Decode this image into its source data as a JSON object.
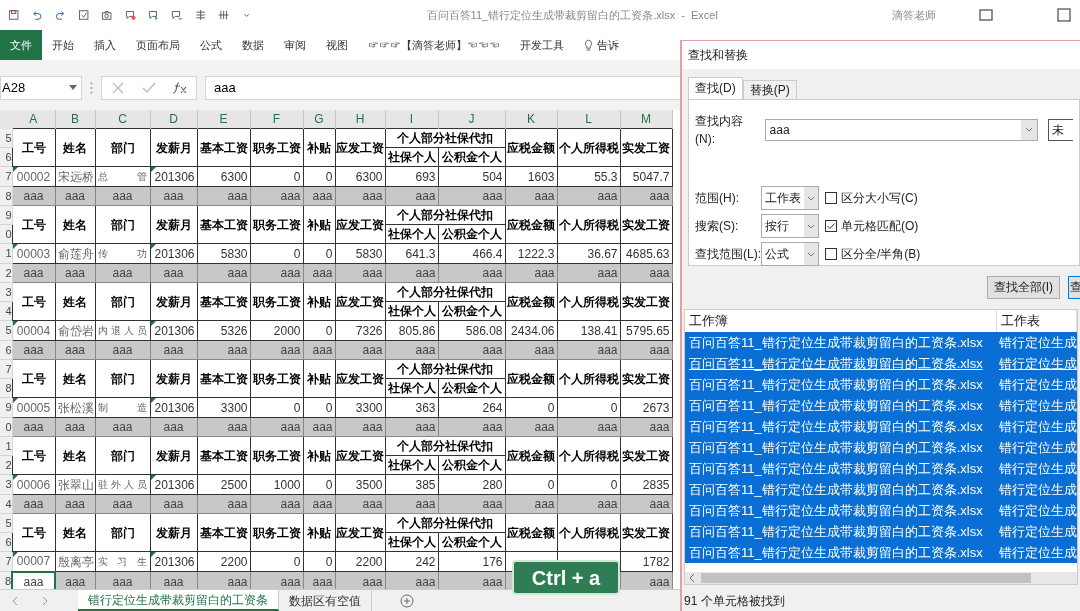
{
  "title_bar": {
    "title": "百问百答11_错行定位生成带裁剪留白的工资条.xlsx  -  Excel",
    "user": "滴答老师"
  },
  "ribbon_tabs": [
    {
      "label": "文件",
      "selected": true
    },
    {
      "label": "开始",
      "selected": false
    },
    {
      "label": "插入",
      "selected": false
    },
    {
      "label": "页面布局",
      "selected": false
    },
    {
      "label": "公式",
      "selected": false
    },
    {
      "label": "数据",
      "selected": false
    },
    {
      "label": "审阅",
      "selected": false
    },
    {
      "label": "视图",
      "selected": false
    },
    {
      "label": "☞☞☞【滴答老师】☜☜☜",
      "selected": false
    },
    {
      "label": "开发工具",
      "selected": false
    },
    {
      "label": "告诉",
      "selected": false
    }
  ],
  "formula_bar": {
    "name_box": "A28",
    "value": "aaa"
  },
  "columns": [
    "A",
    "B",
    "C",
    "D",
    "E",
    "F",
    "G",
    "H",
    "I",
    "J",
    "K",
    "L",
    "M"
  ],
  "blocks": [
    {
      "row_numbers": [
        "5",
        "6",
        "7",
        "8"
      ],
      "headers": [
        "工号",
        "姓名",
        "部门",
        "发薪月",
        "基本工资",
        "职务工资",
        "补贴",
        "应发工资",
        "个人部分社保代扣",
        "社保个人",
        "公积金个人",
        "应税金额",
        "个人所得税",
        "实发工资"
      ],
      "data": [
        "00002",
        "宋远桥",
        "总 管",
        "201306",
        "6300",
        "0",
        "0",
        "6300",
        "693",
        "504",
        "1603",
        "55.3",
        "5047.7"
      ],
      "error_marks": true,
      "filler": [
        "aaa",
        "aaa",
        "aaa",
        "aaa",
        "aaa",
        "aaa",
        "aaa",
        "aaa",
        "aaa",
        "aaa",
        "aaa",
        "aaa",
        "aaa"
      ],
      "first_cell_selected": false
    },
    {
      "row_numbers": [
        "9",
        "0",
        "1",
        "2"
      ],
      "headers": [
        "工号",
        "姓名",
        "部门",
        "发薪月",
        "基本工资",
        "职务工资",
        "补贴",
        "应发工资",
        "个人部分社保代扣",
        "社保个人",
        "公积金个人",
        "应税金额",
        "个人所得税",
        "实发工资"
      ],
      "data": [
        "00003",
        "俞莲舟",
        "传 功",
        "201306",
        "5830",
        "0",
        "0",
        "5830",
        "641.3",
        "466.4",
        "1222.3",
        "36.67",
        "4685.63"
      ],
      "error_marks": true,
      "filler": [
        "aaa",
        "aaa",
        "aaa",
        "aaa",
        "aaa",
        "aaa",
        "aaa",
        "aaa",
        "aaa",
        "aaa",
        "aaa",
        "aaa",
        "aaa"
      ],
      "first_cell_selected": false
    },
    {
      "row_numbers": [
        "3",
        "4",
        "5",
        "6"
      ],
      "headers": [
        "工号",
        "姓名",
        "部门",
        "发薪月",
        "基本工资",
        "职务工资",
        "补贴",
        "应发工资",
        "个人部分社保代扣",
        "社保个人",
        "公积金个人",
        "应税金额",
        "个人所得税",
        "实发工资"
      ],
      "data": [
        "00004",
        "俞岱岩",
        "内 退 人 员",
        "201306",
        "5326",
        "2000",
        "0",
        "7326",
        "805.86",
        "586.08",
        "2434.06",
        "138.41",
        "5795.65"
      ],
      "error_marks": true,
      "filler": [
        "aaa",
        "aaa",
        "aaa",
        "aaa",
        "aaa",
        "aaa",
        "aaa",
        "aaa",
        "aaa",
        "aaa",
        "aaa",
        "aaa",
        "aaa"
      ],
      "first_cell_selected": false
    },
    {
      "row_numbers": [
        "7",
        "8",
        "9",
        "0"
      ],
      "headers": [
        "工号",
        "姓名",
        "部门",
        "发薪月",
        "基本工资",
        "职务工资",
        "补贴",
        "应发工资",
        "个人部分社保代扣",
        "社保个人",
        "公积金个人",
        "应税金额",
        "个人所得税",
        "实发工资"
      ],
      "data": [
        "00005",
        "张松溪",
        "制 造",
        "201306",
        "3300",
        "0",
        "0",
        "3300",
        "363",
        "264",
        "0",
        "0",
        "2673"
      ],
      "error_marks": true,
      "filler": [
        "aaa",
        "aaa",
        "aaa",
        "aaa",
        "aaa",
        "aaa",
        "aaa",
        "aaa",
        "aaa",
        "aaa",
        "aaa",
        "aaa",
        "aaa"
      ],
      "first_cell_selected": false
    },
    {
      "row_numbers": [
        "1",
        "2",
        "3",
        "4"
      ],
      "headers": [
        "工号",
        "姓名",
        "部门",
        "发薪月",
        "基本工资",
        "职务工资",
        "补贴",
        "应发工资",
        "个人部分社保代扣",
        "社保个人",
        "公积金个人",
        "应税金额",
        "个人所得税",
        "实发工资"
      ],
      "data": [
        "00006",
        "张翠山",
        "驻 外 人 员",
        "201306",
        "2500",
        "1000",
        "0",
        "3500",
        "385",
        "280",
        "0",
        "0",
        "2835"
      ],
      "error_marks": true,
      "filler": [
        "aaa",
        "aaa",
        "aaa",
        "aaa",
        "aaa",
        "aaa",
        "aaa",
        "aaa",
        "aaa",
        "aaa",
        "aaa",
        "aaa",
        "aaa"
      ],
      "first_cell_selected": false
    },
    {
      "row_numbers": [
        "5",
        "6",
        "7",
        "8"
      ],
      "headers": [
        "工号",
        "姓名",
        "部门",
        "发薪月",
        "基本工资",
        "职务工资",
        "补贴",
        "应发工资",
        "个人部分社保代扣",
        "社保个人",
        "公积金个人",
        "应税金额",
        "个人所得税",
        "实发工资"
      ],
      "data": [
        "00007",
        "殷离亭",
        "实 习 生",
        "201306",
        "2200",
        "0",
        "0",
        "2200",
        "242",
        "176"
      ],
      "data_last": "1782",
      "error_marks": true,
      "filler": [
        "aaa",
        "aaa",
        "aaa",
        "aaa",
        "aaa",
        "aaa",
        "aaa",
        "aaa",
        "aaa",
        "aaa"
      ],
      "filler_last": "aaa",
      "first_cell_selected": true
    }
  ],
  "sheet_tabs": [
    {
      "label": "错行定位生成带裁剪留白的工资条",
      "selected": true
    },
    {
      "label": "数据区有空值",
      "selected": false
    }
  ],
  "keystroke": "Ctrl + a",
  "dialog": {
    "title": "查找和替换",
    "tabs": [
      {
        "label": "查找(D)",
        "selected": true
      },
      {
        "label": "替换(P)",
        "selected": false
      }
    ],
    "find_label": "查找内容(N):",
    "find_value": "aaa",
    "format_button": "未",
    "selects": [
      {
        "label": "范围(H):",
        "value": "工作表"
      },
      {
        "label": "搜索(S):",
        "value": "按行"
      },
      {
        "label": "查找范围(L):",
        "value": "公式"
      }
    ],
    "options": [
      {
        "label": "区分大小写(C)",
        "checked": false
      },
      {
        "label": "单元格匹配(O)",
        "checked": true
      },
      {
        "label": "区分全/半角(B)",
        "checked": false
      }
    ],
    "buttons": [
      "查找全部(I)",
      "查"
    ],
    "results_columns": [
      "工作簿",
      "工作表"
    ],
    "results": [
      {
        "workbook": "百问百答11_错行定位生成带裁剪留白的工资条.xlsx",
        "sheet": "错行定位生成",
        "selected": true,
        "hover": false
      },
      {
        "workbook": "百问百答11_错行定位生成带裁剪留白的工资条.xlsx",
        "sheet": "错行定位生成",
        "selected": true,
        "hover": true
      },
      {
        "workbook": "百问百答11_错行定位生成带裁剪留白的工资条.xlsx",
        "sheet": "错行定位生成",
        "selected": true,
        "hover": false
      },
      {
        "workbook": "百问百答11_错行定位生成带裁剪留白的工资条.xlsx",
        "sheet": "错行定位生成",
        "selected": true,
        "hover": false
      },
      {
        "workbook": "百问百答11_错行定位生成带裁剪留白的工资条.xlsx",
        "sheet": "错行定位生成",
        "selected": true,
        "hover": false
      },
      {
        "workbook": "百问百答11_错行定位生成带裁剪留白的工资条.xlsx",
        "sheet": "错行定位生成",
        "selected": true,
        "hover": false
      },
      {
        "workbook": "百问百答11_错行定位生成带裁剪留白的工资条.xlsx",
        "sheet": "错行定位生成",
        "selected": true,
        "hover": false
      },
      {
        "workbook": "百问百答11_错行定位生成带裁剪留白的工资条.xlsx",
        "sheet": "错行定位生成",
        "selected": true,
        "hover": false
      },
      {
        "workbook": "百问百答11_错行定位生成带裁剪留白的工资条.xlsx",
        "sheet": "错行定位生成",
        "selected": true,
        "hover": false
      },
      {
        "workbook": "百问百答11_错行定位生成带裁剪留白的工资条.xlsx",
        "sheet": "错行定位生成",
        "selected": true,
        "hover": false
      },
      {
        "workbook": "百问百答11_错行定位生成带裁剪留白的工资条.xlsx",
        "sheet": "错行定位生成",
        "selected": true,
        "hover": false
      }
    ],
    "status": "91 个单元格被找到"
  }
}
